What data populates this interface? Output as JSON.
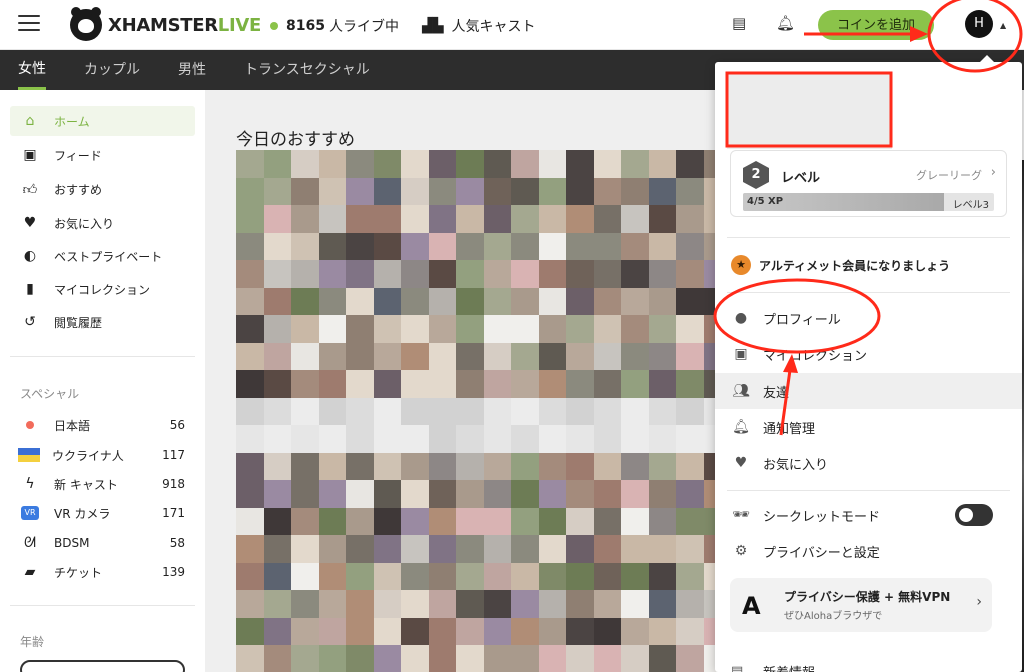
{
  "header": {
    "logo_text_x": "XHAMSTER",
    "logo_text_live": "LIVE",
    "live_count": "8165",
    "live_suffix": "人ライブ中",
    "popular_label": "人気キャスト",
    "coin_button": "コインを追加",
    "avatar_letter": "H"
  },
  "category_tabs": [
    {
      "label": "女性"
    },
    {
      "label": "カップル"
    },
    {
      "label": "男性"
    },
    {
      "label": "トランスセクシャル"
    }
  ],
  "sidebar": {
    "items": [
      {
        "label": "ホーム",
        "icon": "home-icon"
      },
      {
        "label": "フィード",
        "icon": "feed-icon"
      },
      {
        "label": "おすすめ",
        "icon": "thumbs-up-icon"
      },
      {
        "label": "お気に入り",
        "icon": "heart-icon"
      },
      {
        "label": "ベストプライベート",
        "icon": "private-icon"
      },
      {
        "label": "マイコレクション",
        "icon": "bookmark-icon"
      },
      {
        "label": "閲覧履歴",
        "icon": "history-icon"
      }
    ],
    "special_heading": "スペシャル",
    "special_items": [
      {
        "label": "日本語",
        "count": "56"
      },
      {
        "label": "ウクライナ人",
        "count": "117"
      },
      {
        "label": "新 キャスト",
        "count": "918"
      },
      {
        "label": "VR カメラ",
        "count": "171",
        "badge": "VR"
      },
      {
        "label": "BDSM",
        "count": "58"
      },
      {
        "label": "チケット",
        "count": "139"
      }
    ],
    "age_heading": "年齢"
  },
  "main": {
    "section_title": "今日のおすすめ"
  },
  "dropdown": {
    "level": {
      "number": "2",
      "title": "レベル",
      "grade": "グレーリーグ",
      "xp_label": "4/5 XP",
      "next_level": "レベル3",
      "xp_progress": 0.8
    },
    "ultimate": "アルティメット会員になりましょう",
    "items": [
      {
        "label": "プロフィール",
        "icon": "user-icon"
      },
      {
        "label": "マイコレクション",
        "icon": "collection-icon"
      },
      {
        "label": "友達",
        "icon": "friends-icon"
      },
      {
        "label": "通知管理",
        "icon": "bell-icon"
      },
      {
        "label": "お気に入り",
        "icon": "heart-icon"
      },
      {
        "label": "シークレットモード",
        "icon": "incognito-icon"
      },
      {
        "label": "プライバシーと設定",
        "icon": "settings-icon"
      }
    ],
    "vpn": {
      "title": "プライバシー保護 + 無料VPN",
      "subtitle": "ぜひAlohaブラウザで"
    },
    "news": "新着情報"
  },
  "colors": {
    "accent": "#8bc34a",
    "annotation": "#ff2a1a",
    "nav_bg": "#2d2d2d"
  }
}
